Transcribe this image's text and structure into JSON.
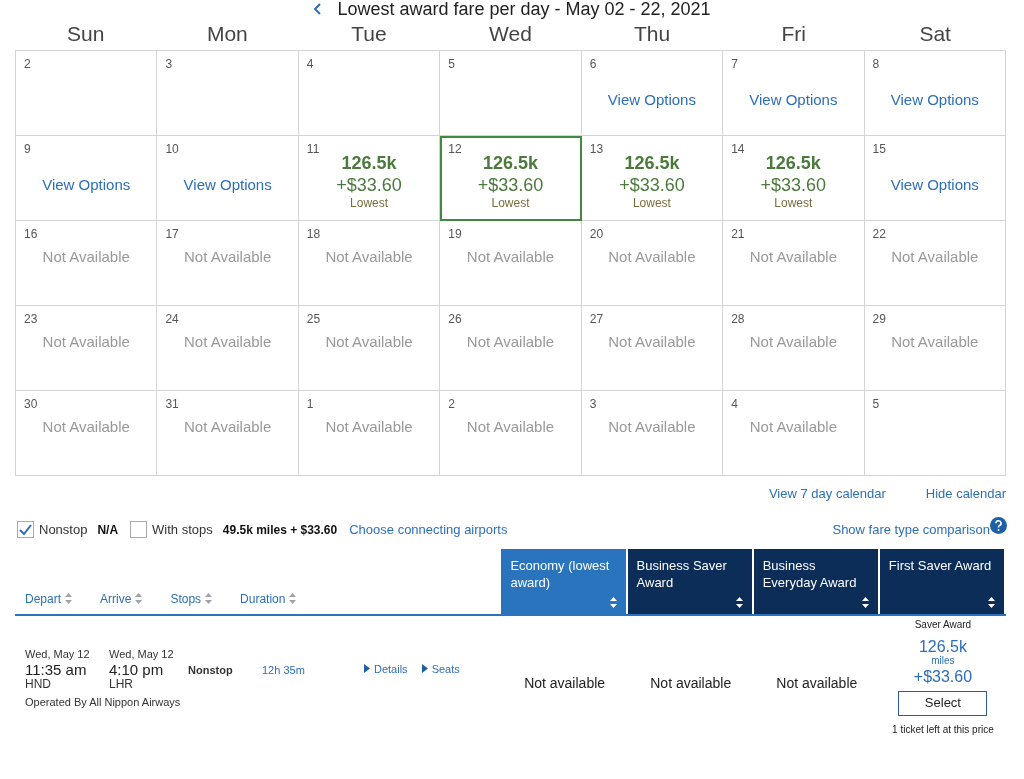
{
  "title": "Lowest award fare per day - May 02 - 22, 2021",
  "weekdays": [
    "Sun",
    "Mon",
    "Tue",
    "Wed",
    "Thu",
    "Fri",
    "Sat"
  ],
  "weeks": [
    [
      {
        "day": "2",
        "kind": "empty",
        "selected": false
      },
      {
        "day": "3",
        "kind": "empty",
        "selected": false
      },
      {
        "day": "4",
        "kind": "empty",
        "selected": false
      },
      {
        "day": "5",
        "kind": "empty",
        "selected": false
      },
      {
        "day": "6",
        "kind": "options",
        "text": "View Options",
        "selected": false
      },
      {
        "day": "7",
        "kind": "options",
        "text": "View Options",
        "selected": false
      },
      {
        "day": "8",
        "kind": "options",
        "text": "View Options",
        "selected": false
      }
    ],
    [
      {
        "day": "9",
        "kind": "options",
        "text": "View Options",
        "selected": false
      },
      {
        "day": "10",
        "kind": "options",
        "text": "View Options",
        "selected": false
      },
      {
        "day": "11",
        "kind": "fare",
        "miles": "126.5k",
        "tax": "+$33.60",
        "note": "Lowest",
        "selected": false
      },
      {
        "day": "12",
        "kind": "fare",
        "miles": "126.5k",
        "tax": "+$33.60",
        "note": "Lowest",
        "selected": true
      },
      {
        "day": "13",
        "kind": "fare",
        "miles": "126.5k",
        "tax": "+$33.60",
        "note": "Lowest",
        "selected": false
      },
      {
        "day": "14",
        "kind": "fare",
        "miles": "126.5k",
        "tax": "+$33.60",
        "note": "Lowest",
        "selected": false
      },
      {
        "day": "15",
        "kind": "options",
        "text": "View Options",
        "selected": false
      }
    ],
    [
      {
        "day": "16",
        "kind": "na",
        "text": "Not Available",
        "selected": false
      },
      {
        "day": "17",
        "kind": "na",
        "text": "Not Available",
        "selected": false
      },
      {
        "day": "18",
        "kind": "na",
        "text": "Not Available",
        "selected": false
      },
      {
        "day": "19",
        "kind": "na",
        "text": "Not Available",
        "selected": false
      },
      {
        "day": "20",
        "kind": "na",
        "text": "Not Available",
        "selected": false
      },
      {
        "day": "21",
        "kind": "na",
        "text": "Not Available",
        "selected": false
      },
      {
        "day": "22",
        "kind": "na",
        "text": "Not Available",
        "selected": false
      }
    ],
    [
      {
        "day": "23",
        "kind": "na",
        "text": "Not Available",
        "selected": false
      },
      {
        "day": "24",
        "kind": "na",
        "text": "Not Available",
        "selected": false
      },
      {
        "day": "25",
        "kind": "na",
        "text": "Not Available",
        "selected": false
      },
      {
        "day": "26",
        "kind": "na",
        "text": "Not Available",
        "selected": false
      },
      {
        "day": "27",
        "kind": "na",
        "text": "Not Available",
        "selected": false
      },
      {
        "day": "28",
        "kind": "na",
        "text": "Not Available",
        "selected": false
      },
      {
        "day": "29",
        "kind": "na",
        "text": "Not Available",
        "selected": false
      }
    ],
    [
      {
        "day": "30",
        "kind": "na",
        "text": "Not Available",
        "selected": false
      },
      {
        "day": "31",
        "kind": "na",
        "text": "Not Available",
        "selected": false
      },
      {
        "day": "1",
        "kind": "na",
        "text": "Not Available",
        "selected": false
      },
      {
        "day": "2",
        "kind": "na",
        "text": "Not Available",
        "selected": false
      },
      {
        "day": "3",
        "kind": "na",
        "text": "Not Available",
        "selected": false
      },
      {
        "day": "4",
        "kind": "na",
        "text": "Not Available",
        "selected": false
      },
      {
        "day": "5",
        "kind": "empty",
        "selected": false
      }
    ]
  ],
  "calendar_links": [
    "View 7 day calendar",
    "Hide calendar"
  ],
  "filters": [
    {
      "label": "Nonstop",
      "checked": true,
      "price": "N/A"
    },
    {
      "label": "With stops",
      "checked": false,
      "price": "49.5k miles + $33.60"
    }
  ],
  "connecting_link": "Choose connecting airports",
  "comparison_link": "Show fare type comparison",
  "sort_columns": [
    "Depart",
    "Arrive",
    "Stops",
    "Duration"
  ],
  "fare_columns": [
    {
      "label": "Economy (lowest award)",
      "selected": true
    },
    {
      "label": "Business Saver Award",
      "selected": false
    },
    {
      "label": "Business Everyday Award",
      "selected": false
    },
    {
      "label": "First Saver Award",
      "selected": false
    }
  ],
  "flight": {
    "depart_date": "Wed, May 12",
    "depart_time": "11:35 am",
    "depart_airport": "HND",
    "arrive_date": "Wed, May 12",
    "arrive_time": "4:10 pm",
    "arrive_airport": "LHR",
    "stops": "Nonstop",
    "duration": "12h 35m",
    "operator": "Operated By All Nippon Airways",
    "links": [
      "Details",
      "Seats"
    ],
    "fares": [
      {
        "kind": "na",
        "text": "Not available"
      },
      {
        "kind": "na",
        "text": "Not available"
      },
      {
        "kind": "na",
        "text": "Not available"
      },
      {
        "kind": "fare",
        "label": "Saver Award",
        "miles": "126.5k",
        "unit": "miles",
        "tax": "+$33.60",
        "button": "Select",
        "note": "1 ticket left at this price"
      }
    ]
  }
}
